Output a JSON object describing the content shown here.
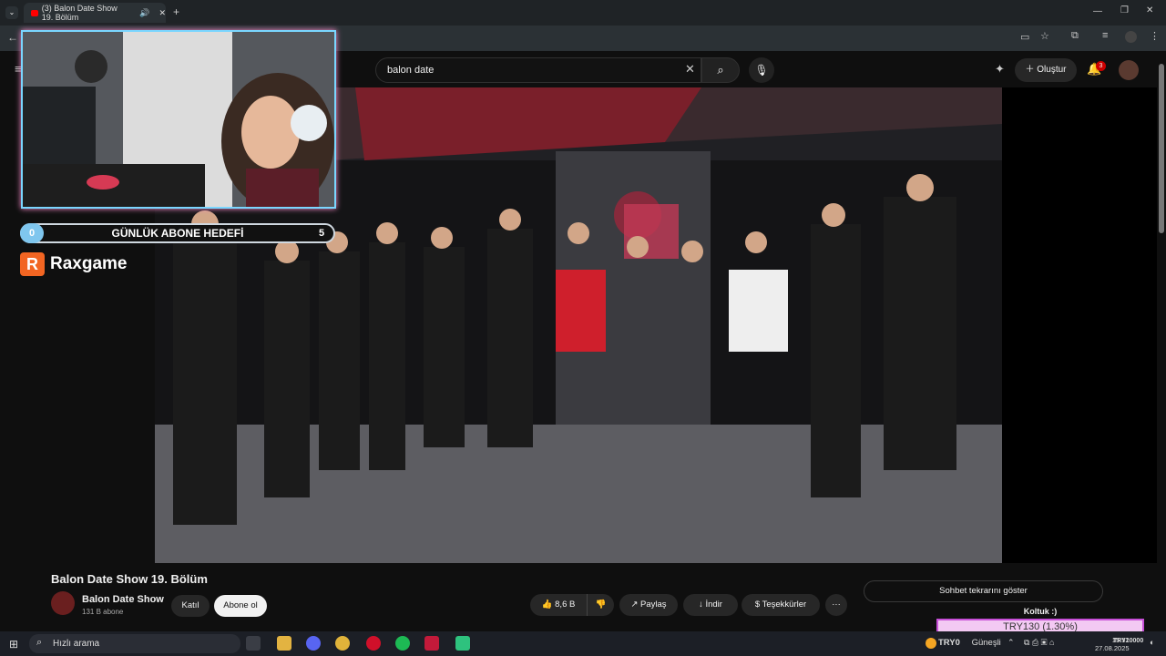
{
  "browser": {
    "tab_title": "(3) Balon Date Show 19. Bölüm",
    "new_tab": "+"
  },
  "youtube": {
    "search_value": "balon date",
    "create_label": "Oluştur",
    "notifications_count": "3"
  },
  "overlay": {
    "goal_start": "0",
    "goal_label": "GÜNLÜK ABONE HEDEFİ",
    "goal_end": "5",
    "brand_letter": "R",
    "brand_name": "Raxgame"
  },
  "video_info": {
    "title": "Balon Date Show 19. Bölüm",
    "channel": "Balon Date Show",
    "subscribers": "131 B abone",
    "join_label": "Katıl",
    "subscribe_label": "Abone ol",
    "likes": "8,6 B",
    "share_label": "Paylaş",
    "download_label": "İndir",
    "thanks_label": "Teşekkürler",
    "more_label": "···"
  },
  "chat": {
    "replay_label": "Sohbet tekrarını göster",
    "donation_title": "Koltuk :)",
    "donation_value": "TRY130 (1.30%)"
  },
  "taskbar": {
    "search_placeholder": "Hızlı arama",
    "weather_value": "TRY0",
    "weather_label": "Güneşli",
    "time": "15:52",
    "date": "27.08.2025",
    "tray_price": "TRY10000"
  },
  "colors": {
    "youtube_red": "#ff0000",
    "overlay_cyan": "#7ad6ff",
    "overlay_pink": "#ff8fd0",
    "brand_orange": "#f26522",
    "donation_bg": "#f3c9f3"
  }
}
